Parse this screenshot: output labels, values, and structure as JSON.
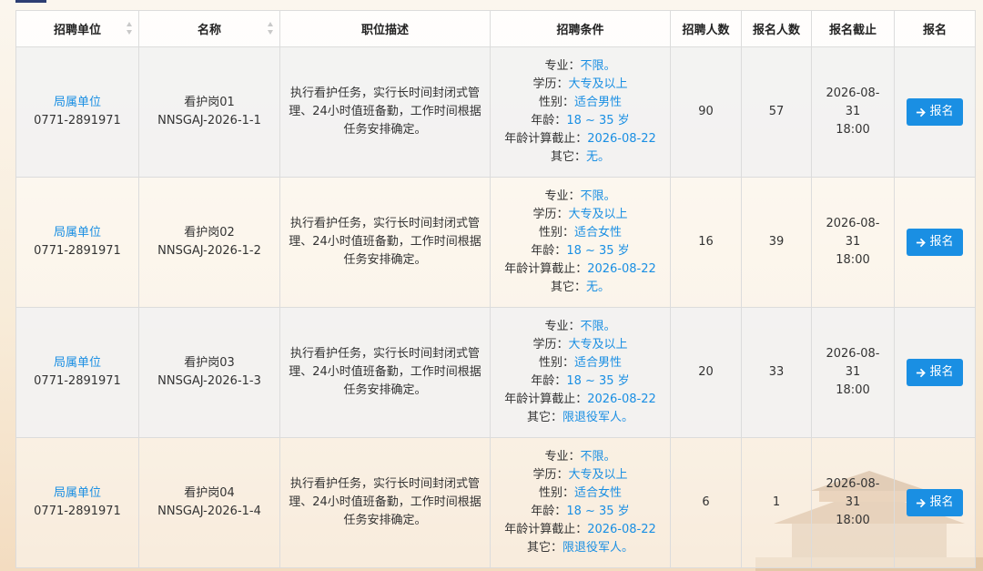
{
  "columns": {
    "unit": "招聘单位",
    "name": "名称",
    "description": "职位描述",
    "requirements": "招聘条件",
    "hiring_count": "招聘人数",
    "applicant_count": "报名人数",
    "deadline": "报名截止",
    "action": "报名"
  },
  "condition_labels": {
    "major": "专业：",
    "education": "学历：",
    "gender": "性别：",
    "age": "年龄：",
    "age_cutoff": "年龄计算截止：",
    "other": "其它："
  },
  "rows": [
    {
      "unit_link": "局属单位",
      "phone": "0771-2891971",
      "title": "看护岗01",
      "code": "NNSGAJ-2026-1-1",
      "description": "执行看护任务，实行长时间封闭式管理、24小时值班备勤，工作时间根据任务安排确定。",
      "major": "不限。",
      "education": "大专及以上",
      "gender": "适合男性",
      "age": "18 ~ 35 岁",
      "age_cutoff": "2026-08-22",
      "other": "无。",
      "hiring": "90",
      "applicants": "57",
      "deadline_date": "2026-08-31",
      "deadline_time": "18:00",
      "apply_label": "报名"
    },
    {
      "unit_link": "局属单位",
      "phone": "0771-2891971",
      "title": "看护岗02",
      "code": "NNSGAJ-2026-1-2",
      "description": "执行看护任务，实行长时间封闭式管理、24小时值班备勤，工作时间根据任务安排确定。",
      "major": "不限。",
      "education": "大专及以上",
      "gender": "适合女性",
      "age": "18 ~ 35 岁",
      "age_cutoff": "2026-08-22",
      "other": "无。",
      "hiring": "16",
      "applicants": "39",
      "deadline_date": "2026-08-31",
      "deadline_time": "18:00",
      "apply_label": "报名"
    },
    {
      "unit_link": "局属单位",
      "phone": "0771-2891971",
      "title": "看护岗03",
      "code": "NNSGAJ-2026-1-3",
      "description": "执行看护任务，实行长时间封闭式管理、24小时值班备勤，工作时间根据任务安排确定。",
      "major": "不限。",
      "education": "大专及以上",
      "gender": "适合男性",
      "age": "18 ~ 35 岁",
      "age_cutoff": "2026-08-22",
      "other": "限退役军人。",
      "hiring": "20",
      "applicants": "33",
      "deadline_date": "2026-08-31",
      "deadline_time": "18:00",
      "apply_label": "报名"
    },
    {
      "unit_link": "局属单位",
      "phone": "0771-2891971",
      "title": "看护岗04",
      "code": "NNSGAJ-2026-1-4",
      "description": "执行看护任务，实行长时间封闭式管理、24小时值班备勤，工作时间根据任务安排确定。",
      "major": "不限。",
      "education": "大专及以上",
      "gender": "适合女性",
      "age": "18 ~ 35 岁",
      "age_cutoff": "2026-08-22",
      "other": "限退役军人。",
      "hiring": "6",
      "applicants": "1",
      "deadline_date": "2026-08-31",
      "deadline_time": "18:00",
      "apply_label": "报名"
    }
  ],
  "icons": {
    "sort": "sort-icon",
    "apply": "arrow-right-icon",
    "background": "palace-roof-decoration"
  },
  "colors": {
    "link": "#1a8fe3",
    "button": "#1a8fe3",
    "header_bg": "#ffffff",
    "row_alt": "#f2f2f2"
  }
}
